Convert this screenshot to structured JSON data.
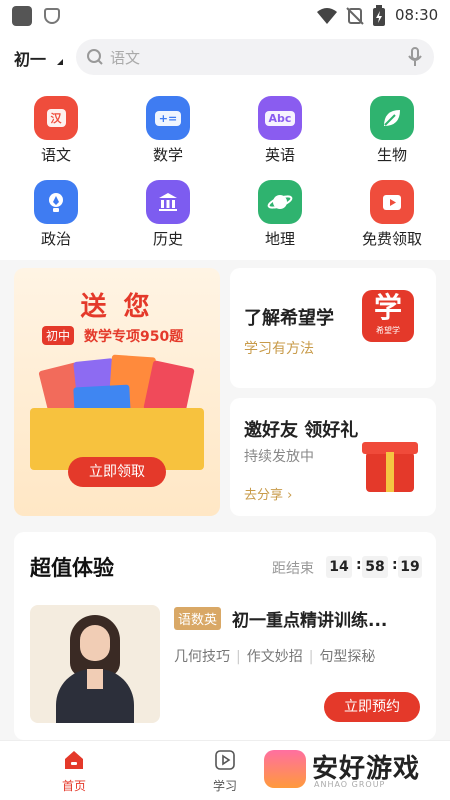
{
  "status_bar": {
    "time": "08:30"
  },
  "header": {
    "grade": "初一",
    "search_placeholder": "语文"
  },
  "subjects": [
    {
      "label": "语文",
      "icon": "chinese-book-icon",
      "color": "#ef4d3c",
      "glyph": "汉"
    },
    {
      "label": "数学",
      "icon": "math-symbols-icon",
      "color": "#3f7cf2",
      "glyph": "+="
    },
    {
      "label": "英语",
      "icon": "english-abc-icon",
      "color": "#8a5cf0",
      "glyph": "Abc"
    },
    {
      "label": "生物",
      "icon": "leaf-icon",
      "color": "#2fb36f",
      "glyph": ""
    },
    {
      "label": "政治",
      "icon": "pen-nib-icon",
      "color": "#3f7cf2",
      "glyph": ""
    },
    {
      "label": "历史",
      "icon": "temple-icon",
      "color": "#7d5cf0",
      "glyph": ""
    },
    {
      "label": "地理",
      "icon": "planet-icon",
      "color": "#2fb36f",
      "glyph": ""
    },
    {
      "label": "免费领取",
      "icon": "play-video-icon",
      "color": "#ef4d3c",
      "glyph": ""
    }
  ],
  "banner": {
    "title": "送 您",
    "tag": "初中",
    "subtitle": "数学专项950题",
    "cta": "立即领取"
  },
  "card_learn": {
    "title": "了解希望学",
    "subtitle": "学习有方法",
    "logo_text": "学",
    "logo_sub": "希望学"
  },
  "card_invite": {
    "title": "邀好友 领好礼",
    "subtitle": "持续发放中",
    "link": "去分享 ›"
  },
  "promo": {
    "title": "超值体验",
    "countdown_label": "距结束",
    "countdown": {
      "h": "14",
      "m": "58",
      "s": "19"
    },
    "course": {
      "tag": "语数英",
      "title": "初一重点精讲训练...",
      "keywords": [
        "几何技巧",
        "作文妙招",
        "句型探秘"
      ],
      "cta": "立即预约"
    }
  },
  "tabs": [
    {
      "label": "首页",
      "icon": "home-icon",
      "active": true
    },
    {
      "label": "学习",
      "icon": "play-square-icon",
      "active": false
    }
  ],
  "watermark": {
    "text": "安好游戏",
    "sub": "ANHAO GROUP"
  },
  "colors": {
    "accent": "#e4392a",
    "gold": "#c89b4a"
  }
}
